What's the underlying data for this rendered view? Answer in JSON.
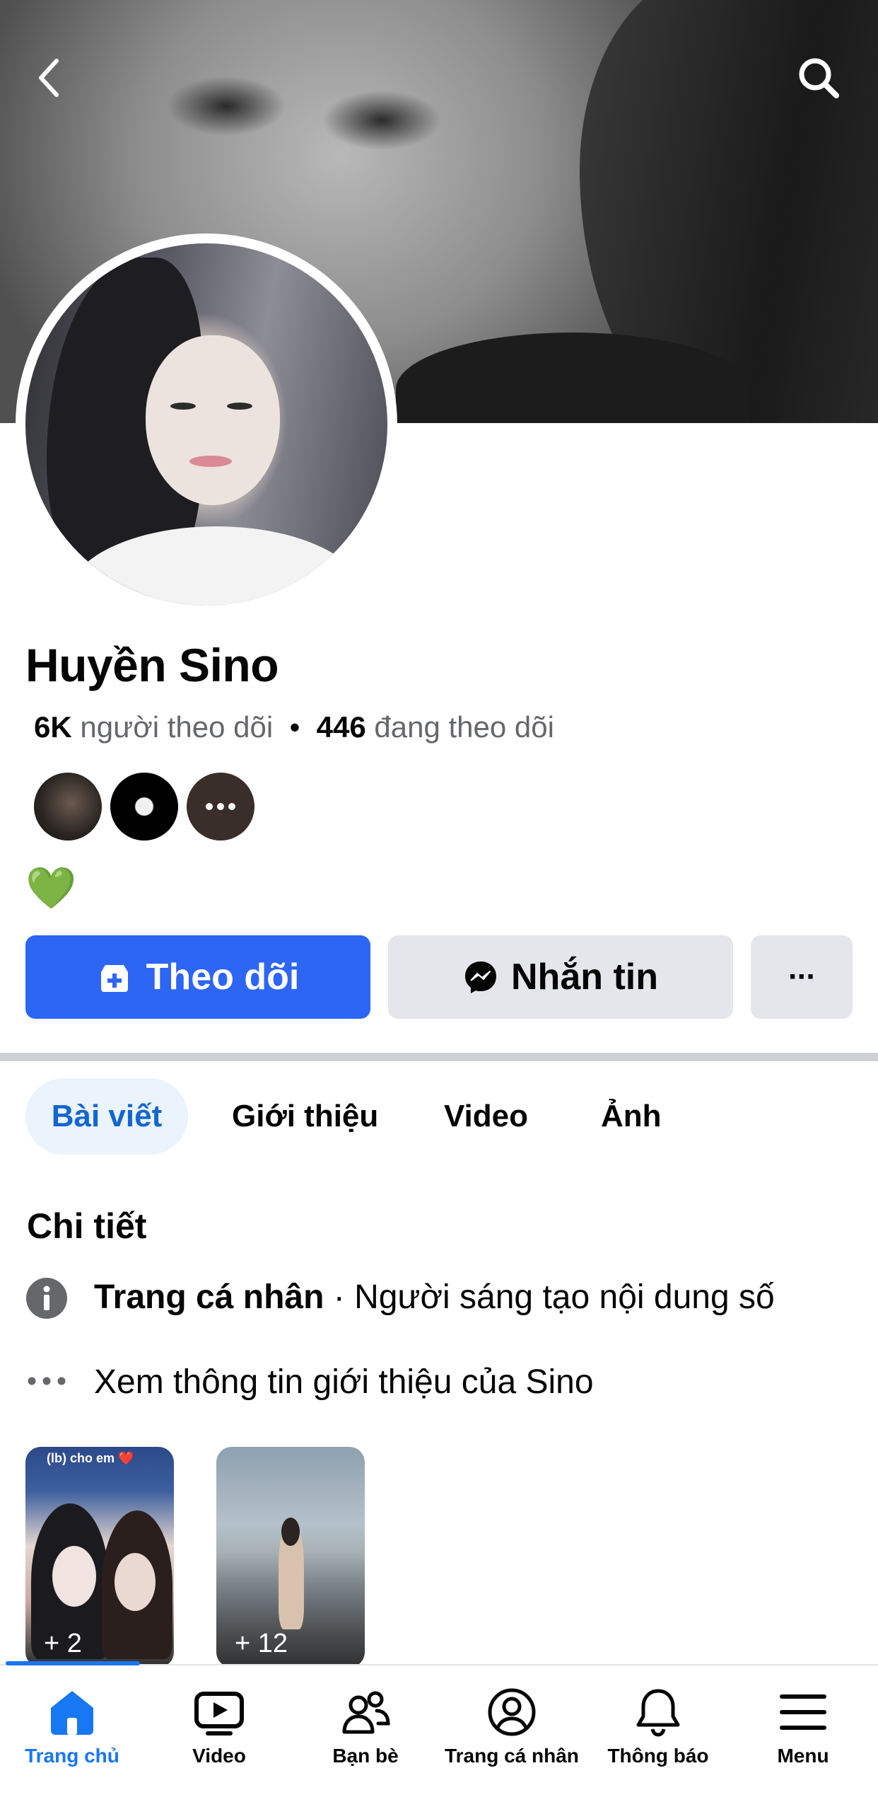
{
  "header": {
    "back_icon": "chevron-left-icon",
    "search_icon": "search-icon"
  },
  "profile": {
    "name": "Huyền Sino",
    "followers_count": "6K",
    "followers_label": "người theo dõi",
    "separator": "•",
    "following_count": "446",
    "following_label": "đang theo dõi",
    "bio_emoji": "💚"
  },
  "actions": {
    "follow_label": "Theo dõi",
    "message_label": "Nhắn tin",
    "more_label": "···"
  },
  "tabs": [
    {
      "label": "Bài viết",
      "active": true
    },
    {
      "label": "Giới thiệu",
      "active": false
    },
    {
      "label": "Video",
      "active": false
    },
    {
      "label": "Ảnh",
      "active": false
    }
  ],
  "details": {
    "title": "Chi tiết",
    "page_type_bold": "Trang cá nhân",
    "page_type_rest": " · Người sáng tạo nội dung số",
    "see_about": "Xem thông tin giới thiệu của Sino"
  },
  "highlights": [
    {
      "caption": "(lb) cho em ❤️",
      "count_label": "+ 2"
    },
    {
      "caption": "",
      "count_label": "+ 12"
    }
  ],
  "bottom_nav": [
    {
      "label": "Trang chủ",
      "icon": "home-icon",
      "active": true
    },
    {
      "label": "Video",
      "icon": "video-icon",
      "active": false
    },
    {
      "label": "Bạn bè",
      "icon": "friends-icon",
      "active": false
    },
    {
      "label": "Trang cá nhân",
      "icon": "profile-icon",
      "active": false
    },
    {
      "label": "Thông báo",
      "icon": "bell-icon",
      "active": false
    },
    {
      "label": "Menu",
      "icon": "menu-icon",
      "active": false
    }
  ],
  "colors": {
    "accent": "#1877f2",
    "follow_button": "#2d65f5",
    "secondary_button": "#e4e6eb",
    "active_tab_bg": "#ebf3fd"
  }
}
